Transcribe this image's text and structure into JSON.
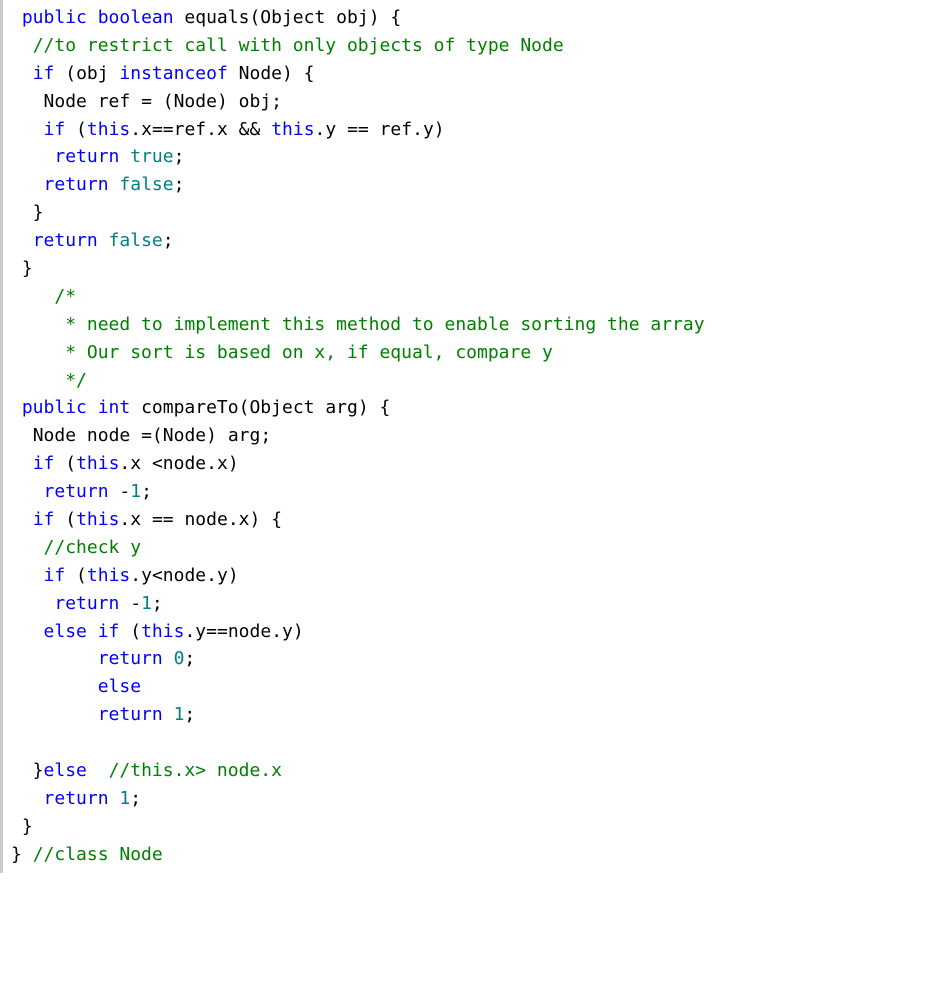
{
  "code": {
    "lines": [
      [
        {
          "cls": "op",
          "t": " "
        },
        {
          "cls": "kw",
          "t": "public"
        },
        {
          "cls": "op",
          "t": " "
        },
        {
          "cls": "kw",
          "t": "boolean"
        },
        {
          "cls": "op",
          "t": " "
        },
        {
          "cls": "id",
          "t": "equals"
        },
        {
          "cls": "op",
          "t": "("
        },
        {
          "cls": "id",
          "t": "Object"
        },
        {
          "cls": "op",
          "t": " "
        },
        {
          "cls": "id",
          "t": "obj"
        },
        {
          "cls": "op",
          "t": ") {"
        }
      ],
      [
        {
          "cls": "op",
          "t": "  "
        },
        {
          "cls": "com",
          "t": "//to restrict call with only objects of type Node"
        }
      ],
      [
        {
          "cls": "op",
          "t": "  "
        },
        {
          "cls": "kw",
          "t": "if"
        },
        {
          "cls": "op",
          "t": " ("
        },
        {
          "cls": "id",
          "t": "obj"
        },
        {
          "cls": "op",
          "t": " "
        },
        {
          "cls": "kw",
          "t": "instanceof"
        },
        {
          "cls": "op",
          "t": " "
        },
        {
          "cls": "id",
          "t": "Node"
        },
        {
          "cls": "op",
          "t": ") {"
        }
      ],
      [
        {
          "cls": "op",
          "t": "   "
        },
        {
          "cls": "id",
          "t": "Node"
        },
        {
          "cls": "op",
          "t": " "
        },
        {
          "cls": "id",
          "t": "ref"
        },
        {
          "cls": "op",
          "t": " = ("
        },
        {
          "cls": "id",
          "t": "Node"
        },
        {
          "cls": "op",
          "t": ") "
        },
        {
          "cls": "id",
          "t": "obj"
        },
        {
          "cls": "op",
          "t": ";"
        }
      ],
      [
        {
          "cls": "op",
          "t": "   "
        },
        {
          "cls": "kw",
          "t": "if"
        },
        {
          "cls": "op",
          "t": " ("
        },
        {
          "cls": "kw",
          "t": "this"
        },
        {
          "cls": "op",
          "t": "."
        },
        {
          "cls": "id",
          "t": "x"
        },
        {
          "cls": "op",
          "t": "=="
        },
        {
          "cls": "id",
          "t": "ref"
        },
        {
          "cls": "op",
          "t": "."
        },
        {
          "cls": "id",
          "t": "x"
        },
        {
          "cls": "op",
          "t": " && "
        },
        {
          "cls": "kw",
          "t": "this"
        },
        {
          "cls": "op",
          "t": "."
        },
        {
          "cls": "id",
          "t": "y"
        },
        {
          "cls": "op",
          "t": " == "
        },
        {
          "cls": "id",
          "t": "ref"
        },
        {
          "cls": "op",
          "t": "."
        },
        {
          "cls": "id",
          "t": "y"
        },
        {
          "cls": "op",
          "t": ")"
        }
      ],
      [
        {
          "cls": "op",
          "t": "    "
        },
        {
          "cls": "kw",
          "t": "return"
        },
        {
          "cls": "op",
          "t": " "
        },
        {
          "cls": "lit",
          "t": "true"
        },
        {
          "cls": "op",
          "t": ";"
        }
      ],
      [
        {
          "cls": "op",
          "t": "   "
        },
        {
          "cls": "kw",
          "t": "return"
        },
        {
          "cls": "op",
          "t": " "
        },
        {
          "cls": "lit",
          "t": "false"
        },
        {
          "cls": "op",
          "t": ";"
        }
      ],
      [
        {
          "cls": "op",
          "t": "  }"
        }
      ],
      [
        {
          "cls": "op",
          "t": "  "
        },
        {
          "cls": "kw",
          "t": "return"
        },
        {
          "cls": "op",
          "t": " "
        },
        {
          "cls": "lit",
          "t": "false"
        },
        {
          "cls": "op",
          "t": ";"
        }
      ],
      [
        {
          "cls": "op",
          "t": " }"
        }
      ],
      [
        {
          "cls": "op",
          "t": "    "
        },
        {
          "cls": "com",
          "t": "/*"
        }
      ],
      [
        {
          "cls": "op",
          "t": "     "
        },
        {
          "cls": "com",
          "t": "* need to implement this method to enable sorting the array"
        }
      ],
      [
        {
          "cls": "op",
          "t": "     "
        },
        {
          "cls": "com",
          "t": "* Our sort is based on x, if equal, compare y"
        }
      ],
      [
        {
          "cls": "op",
          "t": "     "
        },
        {
          "cls": "com",
          "t": "*/"
        }
      ],
      [
        {
          "cls": "op",
          "t": " "
        },
        {
          "cls": "kw",
          "t": "public"
        },
        {
          "cls": "op",
          "t": " "
        },
        {
          "cls": "kw",
          "t": "int"
        },
        {
          "cls": "op",
          "t": " "
        },
        {
          "cls": "id",
          "t": "compareTo"
        },
        {
          "cls": "op",
          "t": "("
        },
        {
          "cls": "id",
          "t": "Object"
        },
        {
          "cls": "op",
          "t": " "
        },
        {
          "cls": "id",
          "t": "arg"
        },
        {
          "cls": "op",
          "t": ") {"
        }
      ],
      [
        {
          "cls": "op",
          "t": "  "
        },
        {
          "cls": "id",
          "t": "Node"
        },
        {
          "cls": "op",
          "t": " "
        },
        {
          "cls": "id",
          "t": "node"
        },
        {
          "cls": "op",
          "t": " =("
        },
        {
          "cls": "id",
          "t": "Node"
        },
        {
          "cls": "op",
          "t": ") "
        },
        {
          "cls": "id",
          "t": "arg"
        },
        {
          "cls": "op",
          "t": ";"
        }
      ],
      [
        {
          "cls": "op",
          "t": "  "
        },
        {
          "cls": "kw",
          "t": "if"
        },
        {
          "cls": "op",
          "t": " ("
        },
        {
          "cls": "kw",
          "t": "this"
        },
        {
          "cls": "op",
          "t": "."
        },
        {
          "cls": "id",
          "t": "x"
        },
        {
          "cls": "op",
          "t": " <"
        },
        {
          "cls": "id",
          "t": "node"
        },
        {
          "cls": "op",
          "t": "."
        },
        {
          "cls": "id",
          "t": "x"
        },
        {
          "cls": "op",
          "t": ")"
        }
      ],
      [
        {
          "cls": "op",
          "t": "   "
        },
        {
          "cls": "kw",
          "t": "return"
        },
        {
          "cls": "op",
          "t": " -"
        },
        {
          "cls": "lit",
          "t": "1"
        },
        {
          "cls": "op",
          "t": ";"
        }
      ],
      [
        {
          "cls": "op",
          "t": "  "
        },
        {
          "cls": "kw",
          "t": "if"
        },
        {
          "cls": "op",
          "t": " ("
        },
        {
          "cls": "kw",
          "t": "this"
        },
        {
          "cls": "op",
          "t": "."
        },
        {
          "cls": "id",
          "t": "x"
        },
        {
          "cls": "op",
          "t": " == "
        },
        {
          "cls": "id",
          "t": "node"
        },
        {
          "cls": "op",
          "t": "."
        },
        {
          "cls": "id",
          "t": "x"
        },
        {
          "cls": "op",
          "t": ") {"
        }
      ],
      [
        {
          "cls": "op",
          "t": "   "
        },
        {
          "cls": "com",
          "t": "//check y"
        }
      ],
      [
        {
          "cls": "op",
          "t": "   "
        },
        {
          "cls": "kw",
          "t": "if"
        },
        {
          "cls": "op",
          "t": " ("
        },
        {
          "cls": "kw",
          "t": "this"
        },
        {
          "cls": "op",
          "t": "."
        },
        {
          "cls": "id",
          "t": "y"
        },
        {
          "cls": "op",
          "t": "<"
        },
        {
          "cls": "id",
          "t": "node"
        },
        {
          "cls": "op",
          "t": "."
        },
        {
          "cls": "id",
          "t": "y"
        },
        {
          "cls": "op",
          "t": ")"
        }
      ],
      [
        {
          "cls": "op",
          "t": "    "
        },
        {
          "cls": "kw",
          "t": "return"
        },
        {
          "cls": "op",
          "t": " -"
        },
        {
          "cls": "lit",
          "t": "1"
        },
        {
          "cls": "op",
          "t": ";"
        }
      ],
      [
        {
          "cls": "op",
          "t": "   "
        },
        {
          "cls": "kw",
          "t": "else"
        },
        {
          "cls": "op",
          "t": " "
        },
        {
          "cls": "kw",
          "t": "if"
        },
        {
          "cls": "op",
          "t": " ("
        },
        {
          "cls": "kw",
          "t": "this"
        },
        {
          "cls": "op",
          "t": "."
        },
        {
          "cls": "id",
          "t": "y"
        },
        {
          "cls": "op",
          "t": "=="
        },
        {
          "cls": "id",
          "t": "node"
        },
        {
          "cls": "op",
          "t": "."
        },
        {
          "cls": "id",
          "t": "y"
        },
        {
          "cls": "op",
          "t": ")"
        }
      ],
      [
        {
          "cls": "op",
          "t": "        "
        },
        {
          "cls": "kw",
          "t": "return"
        },
        {
          "cls": "op",
          "t": " "
        },
        {
          "cls": "lit",
          "t": "0"
        },
        {
          "cls": "op",
          "t": ";"
        }
      ],
      [
        {
          "cls": "op",
          "t": "        "
        },
        {
          "cls": "kw",
          "t": "else"
        }
      ],
      [
        {
          "cls": "op",
          "t": "        "
        },
        {
          "cls": "kw",
          "t": "return"
        },
        {
          "cls": "op",
          "t": " "
        },
        {
          "cls": "lit",
          "t": "1"
        },
        {
          "cls": "op",
          "t": ";"
        }
      ],
      [
        {
          "cls": "op",
          "t": " "
        }
      ],
      [
        {
          "cls": "op",
          "t": "  }"
        },
        {
          "cls": "kw",
          "t": "else"
        },
        {
          "cls": "op",
          "t": "  "
        },
        {
          "cls": "com",
          "t": "//this.x> node.x"
        }
      ],
      [
        {
          "cls": "op",
          "t": "   "
        },
        {
          "cls": "kw",
          "t": "return"
        },
        {
          "cls": "op",
          "t": " "
        },
        {
          "cls": "lit",
          "t": "1"
        },
        {
          "cls": "op",
          "t": ";"
        }
      ],
      [
        {
          "cls": "op",
          "t": " }"
        }
      ],
      [
        {
          "cls": "op",
          "t": "} "
        },
        {
          "cls": "com",
          "t": "//class Node"
        }
      ]
    ]
  }
}
